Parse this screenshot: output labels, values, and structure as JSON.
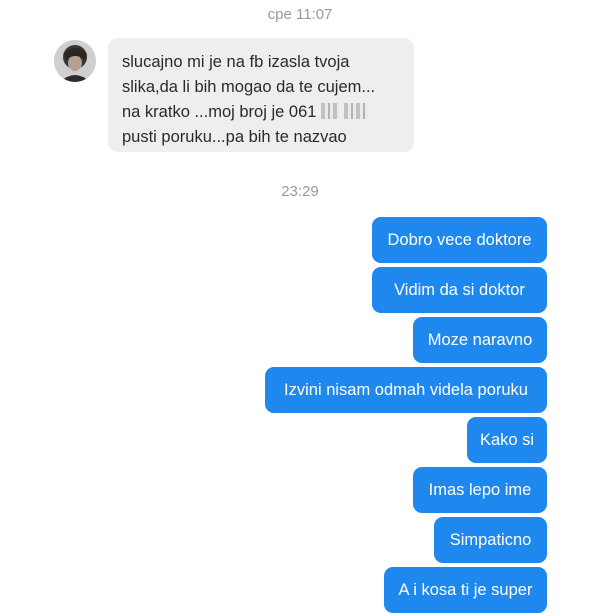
{
  "timestamps": [
    "cpe 11:07",
    "23:29"
  ],
  "incoming": {
    "sender_avatar": "avatar-photo",
    "lines": [
      "slucajno mi je na  fb izasla tvoja",
      "slika,da li bih mogao da te cujem...",
      "na kratko ...moj broj je 061",
      "pusti poruku...pa bih te nazvao"
    ]
  },
  "outgoing": [
    "Dobro vece doktore",
    "Vidim da si doktor",
    "Moze naravno",
    "Izvini nisam odmah videla poruku",
    "Kako si",
    "Imas lepo ime",
    "Simpaticno",
    "A i kosa ti je super"
  ],
  "colors": {
    "outgoing_bubble": "#1e88ef",
    "incoming_bubble": "#eeeeef",
    "timestamp_text": "#9a9a9a"
  }
}
